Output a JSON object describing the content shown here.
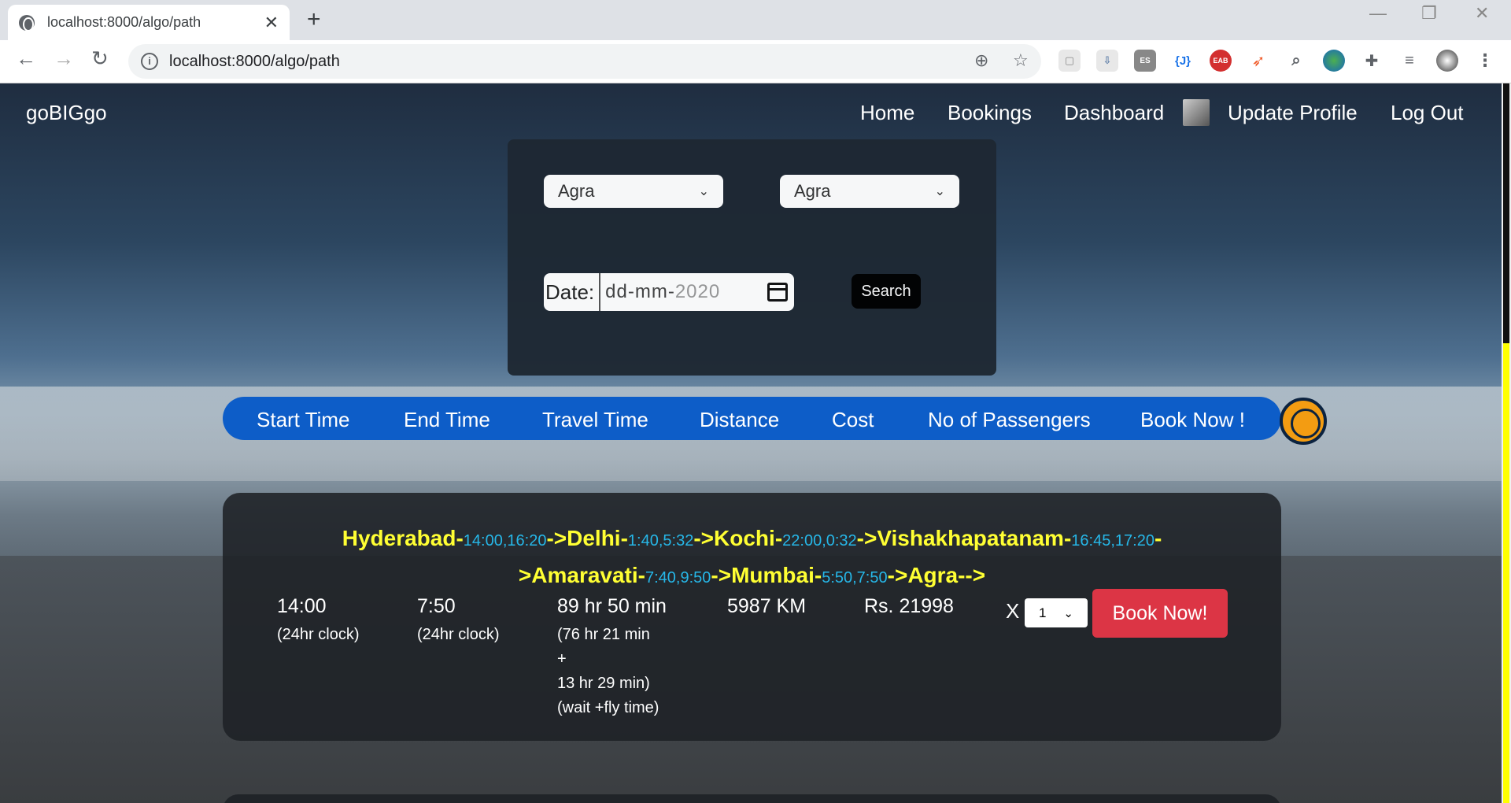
{
  "browser": {
    "tab_title": "localhost:8000/algo/path",
    "url": "localhost:8000/algo/path"
  },
  "navbar": {
    "brand": "goBIGgo",
    "links": [
      "Home",
      "Bookings",
      "Dashboard",
      "Update Profile",
      "Log Out"
    ]
  },
  "search": {
    "from": "Agra",
    "to": "Agra",
    "date_label": "Date:",
    "date_value": "dd-mm-",
    "date_year": "2020",
    "search_button": "Search"
  },
  "results_header": [
    "Start Time",
    "End Time",
    "Travel Time",
    "Distance",
    "Cost",
    "No of Passengers",
    "Book Now !"
  ],
  "result": {
    "route_line1": [
      {
        "city": "Hyderabad",
        "times": "14:00,16:20"
      },
      {
        "city": "Delhi",
        "times": "1:40,5:32"
      },
      {
        "city": "Kochi",
        "times": "22:00,0:32"
      },
      {
        "city": "Vishakhapatanam",
        "times": "16:45,17:20"
      }
    ],
    "route_line2": [
      {
        "city": "Amaravati",
        "times": "7:40,9:50"
      },
      {
        "city": "Mumbai",
        "times": "5:50,7:50"
      },
      {
        "city": "Agra",
        "times": ""
      }
    ],
    "start_time": "14:00",
    "start_note": "(24hr clock)",
    "end_time": "7:50",
    "end_note": "(24hr clock)",
    "travel_time": "89 hr 50 min",
    "travel_wait": "(76 hr 21 min",
    "travel_plus": "+",
    "travel_fly": "13 hr 29 min)",
    "travel_note": "(wait +fly time)",
    "distance": "5987 KM",
    "cost": "Rs. 21998",
    "x_label": "X",
    "passengers": "1",
    "book_button": "Book Now!"
  },
  "colors": {
    "header_bar": "#0d5dc8",
    "route_city": "#ffff33",
    "route_time": "#26b7e8",
    "book_button": "#dc3545",
    "scroll_thumb": "#ffff00"
  }
}
